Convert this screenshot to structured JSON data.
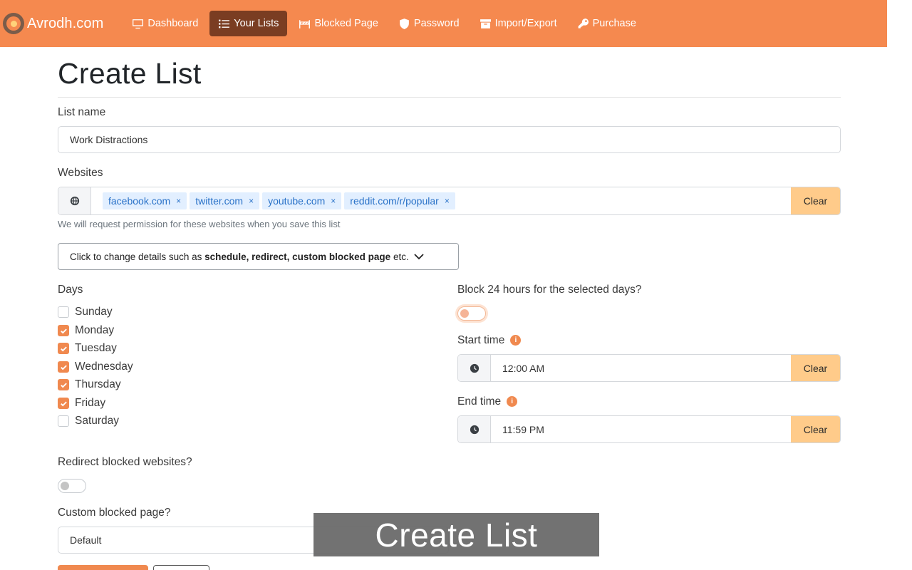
{
  "navbar": {
    "brand": "Avrodh.com",
    "items": [
      {
        "label": "Dashboard",
        "icon": "monitor-icon",
        "active": false
      },
      {
        "label": "Your Lists",
        "icon": "list-icon",
        "active": true
      },
      {
        "label": "Blocked Page",
        "icon": "barrier-icon",
        "active": false
      },
      {
        "label": "Password",
        "icon": "shield-icon",
        "active": false
      },
      {
        "label": "Import/Export",
        "icon": "archive-icon",
        "active": false
      },
      {
        "label": "Purchase",
        "icon": "key-icon",
        "active": false
      }
    ],
    "colors": {
      "background": "#f5894f",
      "active": "#7a3d22"
    }
  },
  "page": {
    "title": "Create List"
  },
  "form": {
    "list_name": {
      "label": "List name",
      "value": "Work Distractions"
    },
    "websites": {
      "label": "Websites",
      "icon": "globe-icon",
      "tags": [
        "facebook.com",
        "twitter.com",
        "youtube.com",
        "reddit.com/r/popular"
      ],
      "remove_glyph": "×",
      "clear_label": "Clear",
      "help": "We will request permission for these websites when you save this list"
    },
    "details_toggle": {
      "prefix": "Click to change details such as ",
      "bold": "schedule, redirect, custom blocked page",
      "suffix": " etc.",
      "icon": "chevron-down-icon"
    },
    "days": {
      "label": "Days",
      "items": [
        {
          "label": "Sunday",
          "checked": false
        },
        {
          "label": "Monday",
          "checked": true
        },
        {
          "label": "Tuesday",
          "checked": true
        },
        {
          "label": "Wednesday",
          "checked": true
        },
        {
          "label": "Thursday",
          "checked": true
        },
        {
          "label": "Friday",
          "checked": true
        },
        {
          "label": "Saturday",
          "checked": false
        }
      ]
    },
    "block_24h": {
      "label": "Block 24 hours for the selected days?",
      "on": false
    },
    "start_time": {
      "label": "Start time",
      "value": "12:00 AM",
      "clear_label": "Clear",
      "icon": "clock-icon",
      "info_icon": "info-icon",
      "info_glyph": "i"
    },
    "end_time": {
      "label": "End time",
      "value": "11:59 PM",
      "clear_label": "Clear",
      "icon": "clock-icon",
      "info_icon": "info-icon",
      "info_glyph": "i"
    },
    "redirect": {
      "label": "Redirect blocked websites?",
      "on": false
    },
    "custom_page": {
      "label": "Custom blocked page?",
      "value": "Default"
    }
  },
  "overlay": {
    "caption": "Create List"
  },
  "accent": "#f0894f"
}
